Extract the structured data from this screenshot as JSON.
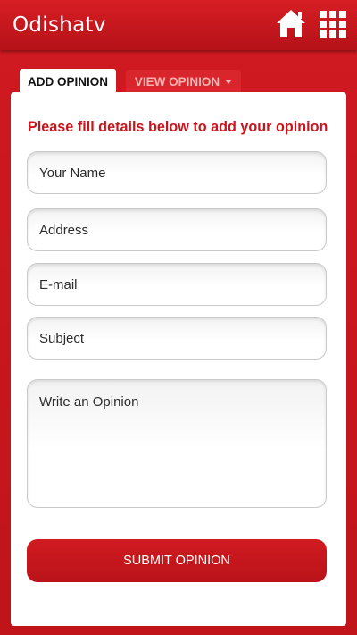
{
  "header": {
    "logo": "Odishatv",
    "home_icon": "home-icon",
    "menu_icon": "grid-menu-icon"
  },
  "tabs": {
    "add_opinion": "ADD OPINION",
    "view_opinion": "VIEW OPINION"
  },
  "form": {
    "intro": "Please fill details below to add your opinion",
    "name_placeholder": "Your Name",
    "address_placeholder": "Address",
    "email_placeholder": "E-mail",
    "subject_placeholder": "Subject",
    "opinion_placeholder": "Write an Opinion",
    "submit_label": "SUBMIT OPINION"
  },
  "colors": {
    "brand_red": "#c8161d",
    "card_bg": "#ffffff",
    "tab_inactive_text": "#f6b3b3"
  }
}
